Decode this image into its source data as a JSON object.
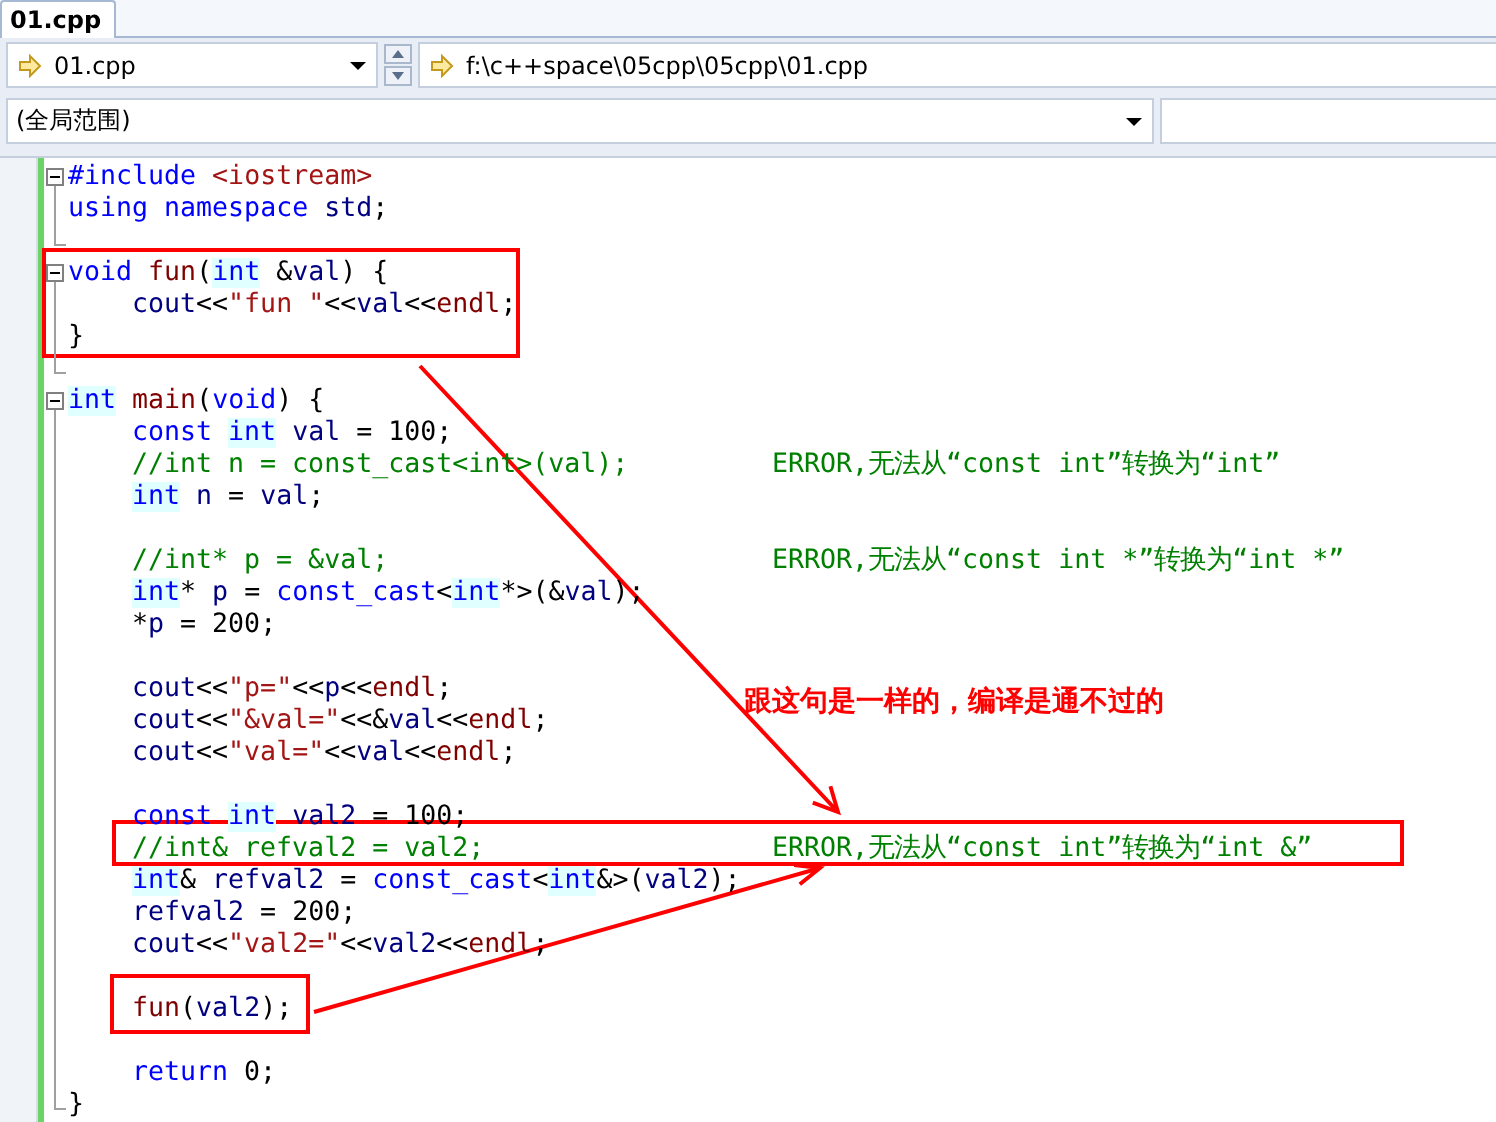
{
  "tabs": [
    {
      "label": "01.cpp",
      "selected": true
    }
  ],
  "navigation": {
    "file": "01.cpp",
    "path": "f:\\c++space\\05cpp\\05cpp\\01.cpp",
    "scope": "(全局范围)"
  },
  "editor": {
    "lines": [
      {
        "collapse_button": true,
        "tokens": [
          {
            "kind": "kw",
            "text": "#include"
          },
          {
            "kind": "str",
            "text": " <iostream>"
          }
        ]
      },
      {
        "guide": true,
        "tokens": [
          {
            "kind": "kw",
            "text": "using namespace"
          },
          {
            "kind": "id",
            "text": " std"
          },
          {
            "kind": "op",
            "text": ";"
          }
        ]
      },
      {
        "block_end": true
      },
      {
        "collapse_button": true,
        "tokens": [
          {
            "kind": "kw",
            "text": "void"
          },
          {
            "kind": "fn",
            "text": " fun"
          },
          {
            "kind": "op",
            "text": "("
          },
          {
            "kind": "type",
            "text": "int"
          },
          {
            "kind": "op",
            "text": " &"
          },
          {
            "kind": "id",
            "text": "val"
          },
          {
            "kind": "op",
            "text": ") {"
          }
        ]
      },
      {
        "guide": true,
        "indented": true,
        "tokens": [
          {
            "kind": "id",
            "text": "cout"
          },
          {
            "kind": "op",
            "text": "<<"
          },
          {
            "kind": "str",
            "text": "\"fun \""
          },
          {
            "kind": "op",
            "text": "<<"
          },
          {
            "kind": "id",
            "text": "val"
          },
          {
            "kind": "op",
            "text": "<<"
          },
          {
            "kind": "fn",
            "text": "endl"
          },
          {
            "kind": "op",
            "text": ";"
          }
        ]
      },
      {
        "guide": true,
        "tokens": [
          {
            "kind": "op",
            "text": "}"
          }
        ]
      },
      {
        "block_end": true
      },
      {
        "collapse_button": true,
        "tokens": [
          {
            "kind": "type",
            "text": "int"
          },
          {
            "kind": "fn",
            "text": " main"
          },
          {
            "kind": "op",
            "text": "("
          },
          {
            "kind": "kw",
            "text": "void"
          },
          {
            "kind": "op",
            "text": ") {"
          }
        ]
      },
      {
        "guide": true,
        "indented": true,
        "tokens": [
          {
            "kind": "kw",
            "text": "const "
          },
          {
            "kind": "type",
            "text": "int"
          },
          {
            "kind": "id",
            "text": " val"
          },
          {
            "kind": "op",
            "text": " = 100;"
          }
        ]
      },
      {
        "guide": true,
        "indented": true,
        "tokens": [
          {
            "kind": "cm",
            "text": "//int n = const_cast<int>(val);"
          }
        ],
        "note": "ERROR,无法从“const int”转换为“int”"
      },
      {
        "guide": true,
        "indented": true,
        "tokens": [
          {
            "kind": "type",
            "text": "int"
          },
          {
            "kind": "id",
            "text": " n"
          },
          {
            "kind": "op",
            "text": " = "
          },
          {
            "kind": "id",
            "text": "val"
          },
          {
            "kind": "op",
            "text": ";"
          }
        ]
      },
      {
        "guide": true
      },
      {
        "guide": true,
        "indented": true,
        "tokens": [
          {
            "kind": "cm",
            "text": "//int* p = &val;"
          }
        ],
        "note": "ERROR,无法从“const int *”转换为“int *”"
      },
      {
        "guide": true,
        "indented": true,
        "tokens": [
          {
            "kind": "type",
            "text": "int"
          },
          {
            "kind": "op",
            "text": "* "
          },
          {
            "kind": "id",
            "text": "p"
          },
          {
            "kind": "op",
            "text": " = "
          },
          {
            "kind": "kw",
            "text": "const_cast"
          },
          {
            "kind": "op",
            "text": "<"
          },
          {
            "kind": "type",
            "text": "int"
          },
          {
            "kind": "op",
            "text": "*>(&"
          },
          {
            "kind": "id",
            "text": "val"
          },
          {
            "kind": "op",
            "text": ");"
          }
        ]
      },
      {
        "guide": true,
        "indented": true,
        "tokens": [
          {
            "kind": "op",
            "text": "*"
          },
          {
            "kind": "id",
            "text": "p"
          },
          {
            "kind": "op",
            "text": " = 200;"
          }
        ]
      },
      {
        "guide": true
      },
      {
        "guide": true,
        "indented": true,
        "tokens": [
          {
            "kind": "id",
            "text": "cout"
          },
          {
            "kind": "op",
            "text": "<<"
          },
          {
            "kind": "str",
            "text": "\"p=\""
          },
          {
            "kind": "op",
            "text": "<<"
          },
          {
            "kind": "id",
            "text": "p"
          },
          {
            "kind": "op",
            "text": "<<"
          },
          {
            "kind": "fn",
            "text": "endl"
          },
          {
            "kind": "op",
            "text": ";"
          }
        ]
      },
      {
        "guide": true,
        "indented": true,
        "tokens": [
          {
            "kind": "id",
            "text": "cout"
          },
          {
            "kind": "op",
            "text": "<<"
          },
          {
            "kind": "str",
            "text": "\"&val=\""
          },
          {
            "kind": "op",
            "text": "<<&"
          },
          {
            "kind": "id",
            "text": "val"
          },
          {
            "kind": "op",
            "text": "<<"
          },
          {
            "kind": "fn",
            "text": "endl"
          },
          {
            "kind": "op",
            "text": ";"
          }
        ]
      },
      {
        "guide": true,
        "indented": true,
        "tokens": [
          {
            "kind": "id",
            "text": "cout"
          },
          {
            "kind": "op",
            "text": "<<"
          },
          {
            "kind": "str",
            "text": "\"val=\""
          },
          {
            "kind": "op",
            "text": "<<"
          },
          {
            "kind": "id",
            "text": "val"
          },
          {
            "kind": "op",
            "text": "<<"
          },
          {
            "kind": "fn",
            "text": "endl"
          },
          {
            "kind": "op",
            "text": ";"
          }
        ]
      },
      {
        "guide": true
      },
      {
        "guide": true,
        "indented": true,
        "tokens": [
          {
            "kind": "kw",
            "text": "const "
          },
          {
            "kind": "type",
            "text": "int"
          },
          {
            "kind": "id",
            "text": " val2"
          },
          {
            "kind": "op",
            "text": " = 100;"
          }
        ]
      },
      {
        "guide": true,
        "indented": true,
        "tokens": [
          {
            "kind": "cm",
            "text": "//int& refval2 = val2;"
          }
        ],
        "note": "ERROR,无法从“const int”转换为“int &”"
      },
      {
        "guide": true,
        "indented": true,
        "tokens": [
          {
            "kind": "type",
            "text": "int"
          },
          {
            "kind": "op",
            "text": "& "
          },
          {
            "kind": "id",
            "text": "refval2"
          },
          {
            "kind": "op",
            "text": " = "
          },
          {
            "kind": "kw",
            "text": "const_cast"
          },
          {
            "kind": "op",
            "text": "<"
          },
          {
            "kind": "type",
            "text": "int"
          },
          {
            "kind": "op",
            "text": "&>("
          },
          {
            "kind": "id",
            "text": "val2"
          },
          {
            "kind": "op",
            "text": ");"
          }
        ]
      },
      {
        "guide": true,
        "indented": true,
        "tokens": [
          {
            "kind": "id",
            "text": "refval2"
          },
          {
            "kind": "op",
            "text": " = 200;"
          }
        ]
      },
      {
        "guide": true,
        "indented": true,
        "tokens": [
          {
            "kind": "id",
            "text": "cout"
          },
          {
            "kind": "op",
            "text": "<<"
          },
          {
            "kind": "str",
            "text": "\"val2=\""
          },
          {
            "kind": "op",
            "text": "<<"
          },
          {
            "kind": "id",
            "text": "val2"
          },
          {
            "kind": "op",
            "text": "<<"
          },
          {
            "kind": "fn",
            "text": "endl"
          },
          {
            "kind": "op",
            "text": ";"
          }
        ]
      },
      {
        "guide": true
      },
      {
        "guide": true,
        "indented": true,
        "tokens": [
          {
            "kind": "fn",
            "text": "fun"
          },
          {
            "kind": "op",
            "text": "("
          },
          {
            "kind": "id",
            "text": "val2"
          },
          {
            "kind": "op",
            "text": ");"
          }
        ]
      },
      {
        "guide": true
      },
      {
        "guide": true,
        "indented": true,
        "tokens": [
          {
            "kind": "kw",
            "text": "return"
          },
          {
            "kind": "op",
            "text": " 0;"
          }
        ]
      },
      {
        "block_end": true,
        "tokens": [
          {
            "kind": "op",
            "text": "}"
          }
        ]
      }
    ]
  },
  "annotation": {
    "text": "跟这句是一样的，编译是通不过的"
  }
}
